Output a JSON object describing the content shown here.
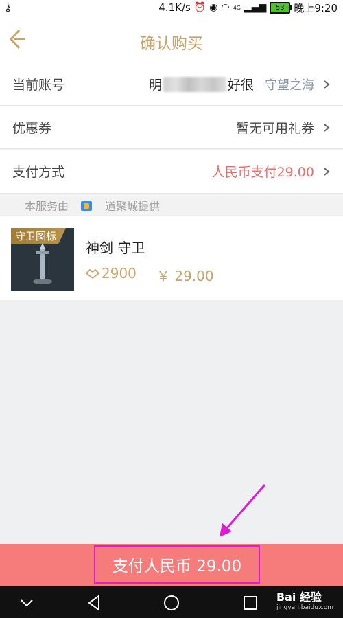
{
  "status_bar": {
    "network_speed": "4.1K/s",
    "network_type": "4G",
    "battery": "53",
    "time": "晚上9:20"
  },
  "header": {
    "title": "确认购买"
  },
  "account": {
    "label": "当前账号",
    "name_prefix": "明",
    "name_suffix": "好很",
    "server": "守望之海"
  },
  "coupon": {
    "label": "优惠券",
    "value": "暂无可用礼券"
  },
  "payment_method": {
    "label": "支付方式",
    "value": "人民币支付29.00"
  },
  "notice": {
    "before": "本服务由",
    "after": "道聚城提供"
  },
  "product": {
    "badge": "守卫图标",
    "name": "神剑 守卫",
    "coins": "2900",
    "price": "￥ 29.00"
  },
  "pay_button": {
    "label": "支付人民币 29.00"
  },
  "watermark": {
    "brand": "Bai 经验",
    "url": "jingyan.baidu.com"
  },
  "colors": {
    "accent_gold": "#c9a46a",
    "pay_red": "#f67b7b",
    "highlight_pink": "#e01bd6",
    "price_red": "#f06a6a"
  }
}
